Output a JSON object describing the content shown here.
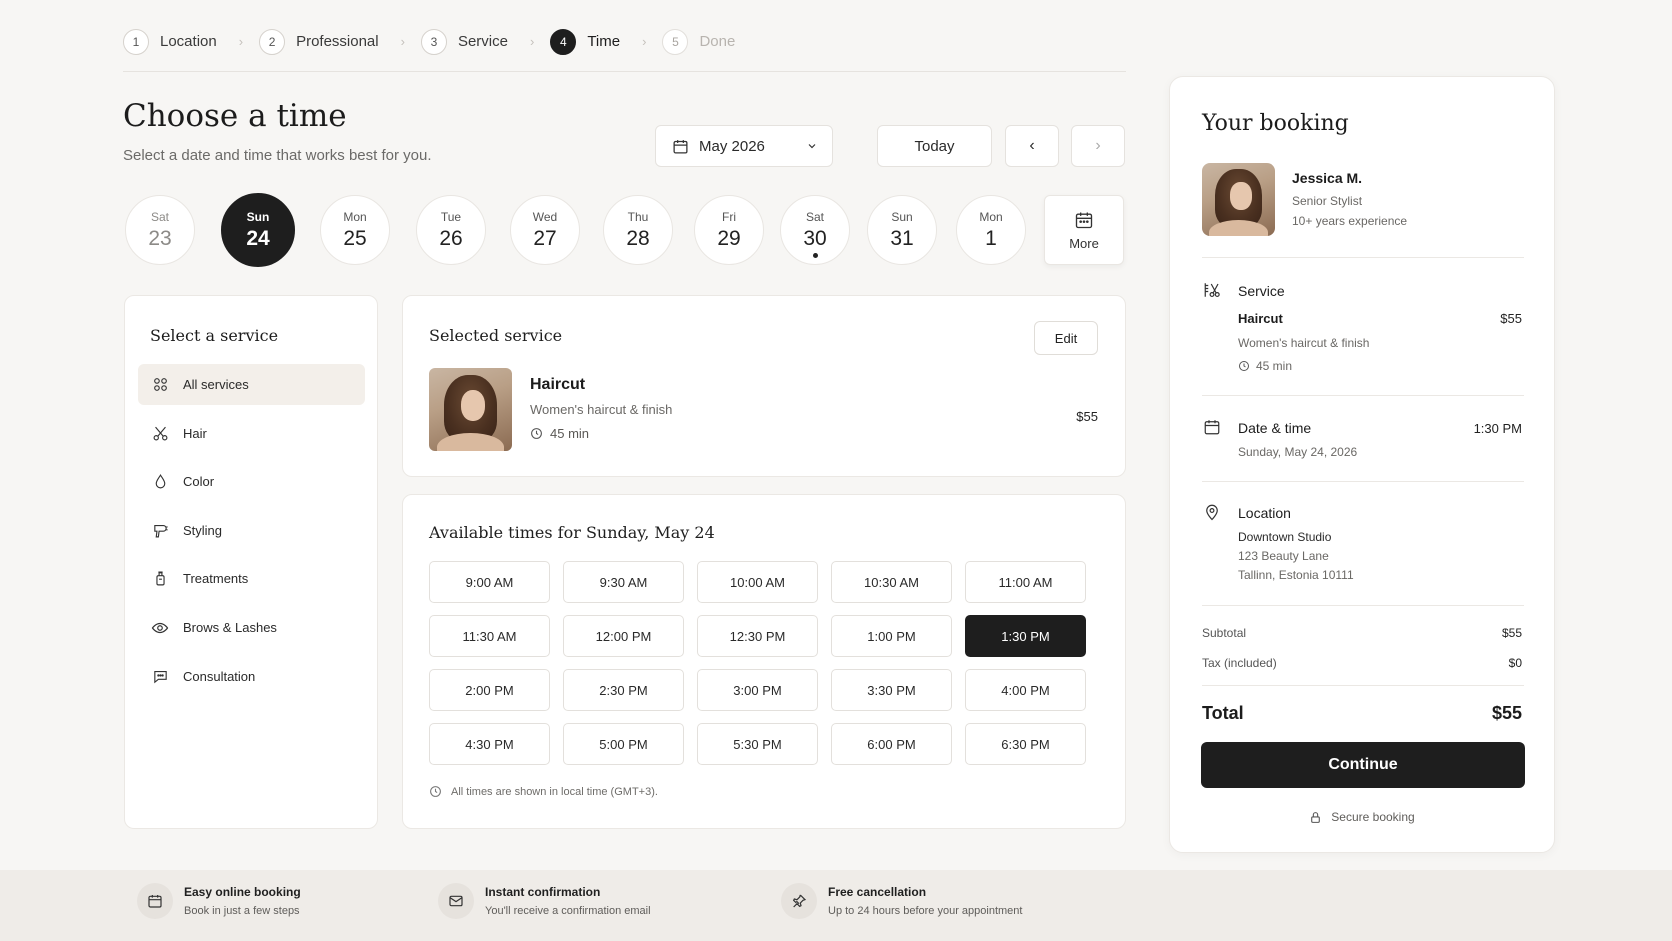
{
  "stepper": [
    {
      "num": "1",
      "label": "Location",
      "state": "done"
    },
    {
      "num": "2",
      "label": "Professional",
      "state": "done"
    },
    {
      "num": "3",
      "label": "Service",
      "state": "done"
    },
    {
      "num": "4",
      "label": "Time",
      "state": "active"
    },
    {
      "num": "5",
      "label": "Done",
      "state": "future"
    }
  ],
  "header": {
    "title": "Choose a time",
    "subtitle": "Select a date and time that works best for you."
  },
  "controls": {
    "month": "May 2026",
    "today": "Today",
    "prev_glyph": "‹",
    "next_glyph": "›"
  },
  "days": [
    {
      "dow": "Sat",
      "num": "23",
      "state": "past"
    },
    {
      "dow": "Sun",
      "num": "24",
      "state": "selected"
    },
    {
      "dow": "Mon",
      "num": "25",
      "state": "normal"
    },
    {
      "dow": "Tue",
      "num": "26",
      "state": "normal"
    },
    {
      "dow": "Wed",
      "num": "27",
      "state": "normal"
    },
    {
      "dow": "Thu",
      "num": "28",
      "state": "normal"
    },
    {
      "dow": "Fri",
      "num": "29",
      "state": "normal"
    },
    {
      "dow": "Sat",
      "num": "30",
      "state": "dot"
    },
    {
      "dow": "Sun",
      "num": "31",
      "state": "normal"
    },
    {
      "dow": "Mon",
      "num": "1",
      "state": "normal"
    }
  ],
  "more_label": "More",
  "service_list": {
    "title": "Select a service",
    "items": [
      {
        "label": "All services",
        "icon": "grid-icon",
        "active": true
      },
      {
        "label": "Hair",
        "icon": "scissors-icon",
        "active": false
      },
      {
        "label": "Color",
        "icon": "droplet-icon",
        "active": false
      },
      {
        "label": "Styling",
        "icon": "hairdryer-icon",
        "active": false
      },
      {
        "label": "Treatments",
        "icon": "bottle-icon",
        "active": false
      },
      {
        "label": "Brows & Lashes",
        "icon": "eye-icon",
        "active": false
      },
      {
        "label": "Consultation",
        "icon": "chat-icon",
        "active": false
      }
    ]
  },
  "selected_service": {
    "title": "Selected service",
    "edit": "Edit",
    "name": "Haircut",
    "desc": "Women's haircut & finish",
    "duration": "45 min",
    "price": "$55"
  },
  "times": {
    "title": "Available times for Sunday, May 24",
    "slots": [
      "9:00 AM",
      "9:30 AM",
      "10:00 AM",
      "10:30 AM",
      "11:00 AM",
      "11:30 AM",
      "12:00 PM",
      "12:30 PM",
      "1:00 PM",
      "1:30 PM",
      "2:00 PM",
      "2:30 PM",
      "3:00 PM",
      "3:30 PM",
      "4:00 PM",
      "4:30 PM",
      "5:00 PM",
      "5:30 PM",
      "6:00 PM",
      "6:30 PM"
    ],
    "selected": "1:30 PM",
    "tz_note": "All times are shown in local time (GMT+3)."
  },
  "booking": {
    "title": "Your booking",
    "pro_name": "Jessica M.",
    "pro_role": "Senior Stylist",
    "pro_exp": "10+ years experience",
    "service_label": "Service",
    "service_name": "Haircut",
    "service_price": "$55",
    "service_desc": "Women's haircut & finish",
    "service_duration": "45 min",
    "datetime_label": "Date & time",
    "datetime_time": "1:30 PM",
    "datetime_date": "Sunday, May 24, 2026",
    "location_label": "Location",
    "location_name": "Downtown Studio",
    "location_addr1": "123 Beauty Lane",
    "location_addr2": "Tallinn, Estonia 10111",
    "subtotal_label": "Subtotal",
    "subtotal": "$55",
    "tax_label": "Tax (included)",
    "tax": "$0",
    "total_label": "Total",
    "total": "$55",
    "continue": "Continue",
    "secure": "Secure booking"
  },
  "footer": [
    {
      "title": "Easy online booking",
      "sub": "Book in just a few steps",
      "icon": "calendar-icon"
    },
    {
      "title": "Instant confirmation",
      "sub": "You'll receive a confirmation email",
      "icon": "mail-icon"
    },
    {
      "title": "Free cancellation",
      "sub": "Up to 24 hours before your appointment",
      "icon": "pin-icon"
    }
  ],
  "colors": {
    "accent": "#1e1e1e",
    "background": "#f7f6f4",
    "card": "#ffffff",
    "active_item": "#f3efea"
  }
}
